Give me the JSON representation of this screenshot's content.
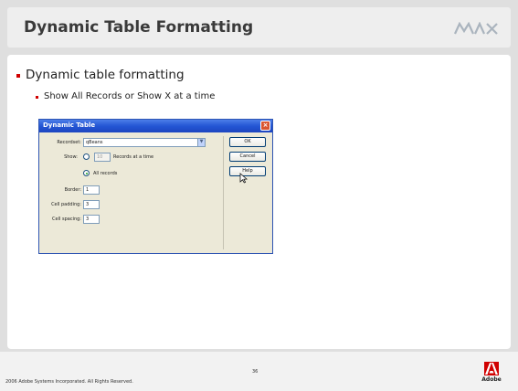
{
  "slide": {
    "title": "Dynamic Table Formatting",
    "bullet_1": "Dynamic table formatting",
    "bullet_2": "Show All Records or Show X at a time"
  },
  "dialog": {
    "title": "Dynamic Table",
    "recordset_label": "Recordset:",
    "recordset_value": "qBeans",
    "show_label": "Show:",
    "show_count_value": "10",
    "records_at_a_time": "Records at a time",
    "all_records": "All records",
    "border_label": "Border:",
    "border_value": "1",
    "cell_padding_label": "Cell padding:",
    "cell_padding_value": "3",
    "cell_spacing_label": "Cell spacing:",
    "cell_spacing_value": "3",
    "ok_label": "OK",
    "cancel_label": "Cancel",
    "help_label": "Help",
    "selected_option": "All records"
  },
  "footer": {
    "copyright": "2006 Adobe Systems Incorporated.  All Rights Reserved.",
    "page_number": "36",
    "adobe_word": "Adobe"
  },
  "colors": {
    "accent": "#d00000",
    "titlebar": "#2456d4",
    "dialog_bg": "#ece9d8"
  }
}
